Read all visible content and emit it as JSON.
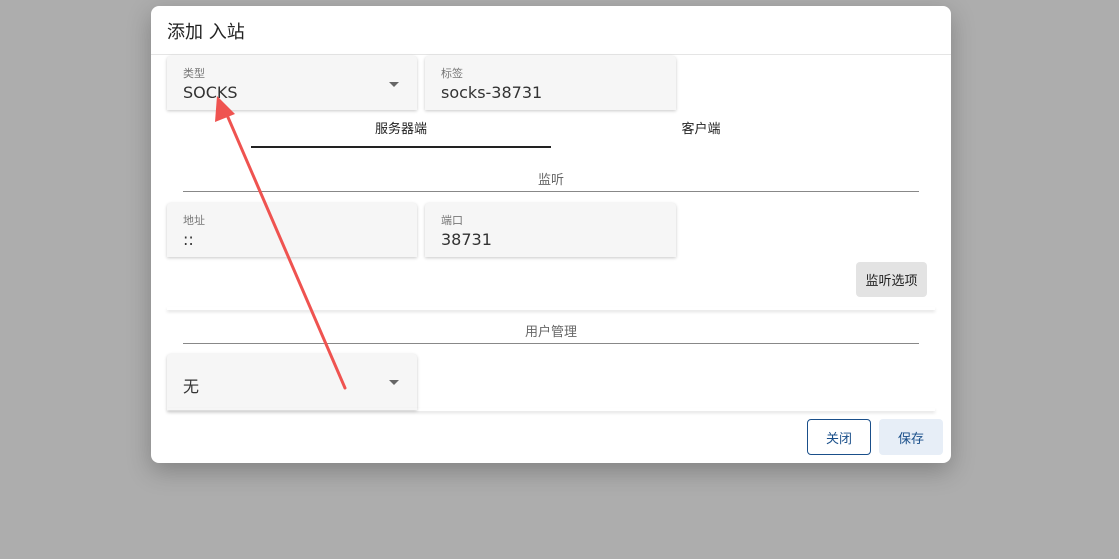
{
  "dialog": {
    "title": "添加 入站"
  },
  "fields": {
    "type": {
      "label": "类型",
      "value": "SOCKS"
    },
    "tag": {
      "label": "标签",
      "value": "socks-38731"
    },
    "address": {
      "label": "地址",
      "value": "::"
    },
    "port": {
      "label": "端口",
      "value": "38731"
    },
    "auth": {
      "value": "无"
    }
  },
  "tabs": [
    {
      "label": "服务器端",
      "active": true
    },
    {
      "label": "客户端",
      "active": false
    }
  ],
  "sections": {
    "listen": "监听",
    "users": "用户管理"
  },
  "buttons": {
    "listen_options": "监听选项",
    "close": "关闭",
    "save": "保存"
  },
  "colors": {
    "accent": "#1a4f8a",
    "annotation_arrow": "#ef5350"
  }
}
